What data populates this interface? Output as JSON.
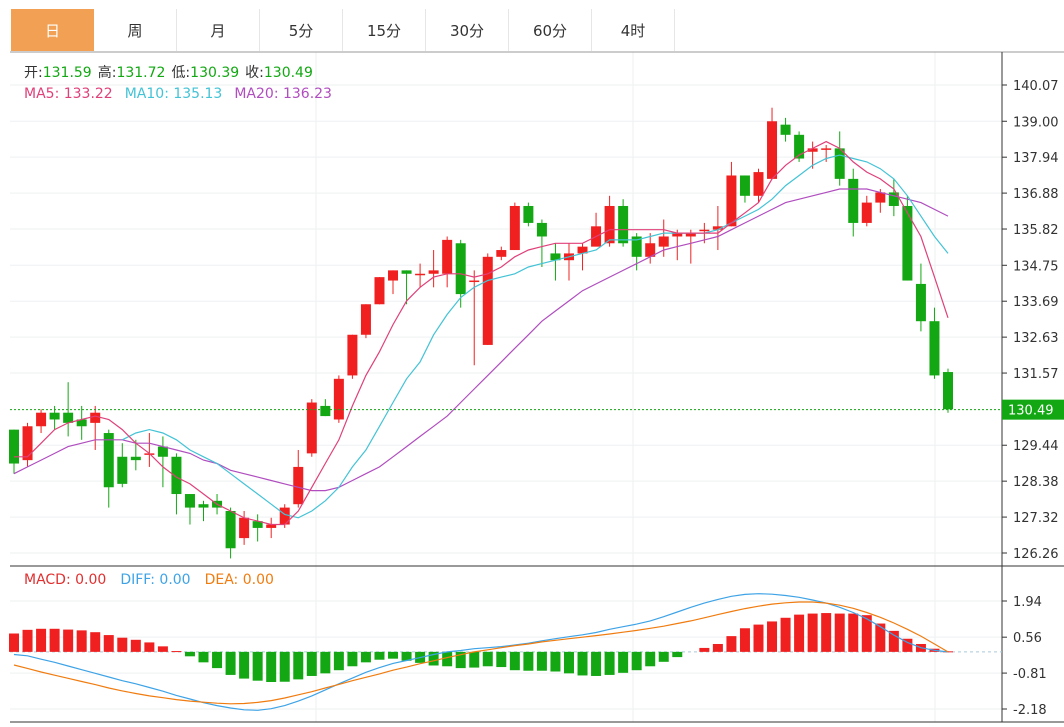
{
  "tabs": [
    "日",
    "周",
    "月",
    "5分",
    "15分",
    "30分",
    "60分",
    "4时"
  ],
  "active_tab": 0,
  "ohlc_label": {
    "open_k": "开:",
    "open": "131.59",
    "high_k": "高:",
    "high": "131.72",
    "low_k": "低:",
    "low": "130.39",
    "close_k": "收:",
    "close": "130.49"
  },
  "ma_label": {
    "ma5": "MA5: 133.22",
    "ma10": "MA10: 135.13",
    "ma20": "MA20: 136.23"
  },
  "macd_label": {
    "macd": "MACD: 0.00",
    "diff": "DIFF: 0.00",
    "dea": "DEA: 0.00"
  },
  "last_price": "130.49",
  "colors": {
    "up": "#f02020",
    "down": "#13a813",
    "ma5": "#e0407a",
    "ma10": "#43c3d6",
    "ma20": "#b04dbf",
    "diff": "#3ea3e6",
    "dea": "#f07c10",
    "accent": "#f2a053"
  },
  "chart_data": {
    "type": "candlestick",
    "price_axis": [
      "140.07",
      "139.00",
      "137.94",
      "136.88",
      "135.82",
      "134.75",
      "133.69",
      "132.63",
      "131.57",
      "129.44",
      "128.38",
      "127.32",
      "126.26"
    ],
    "price_ylim": [
      126.26,
      140.07
    ],
    "macd_axis": [
      "1.94",
      "0.56",
      "-0.81",
      "-2.18"
    ],
    "macd_ylim": [
      -2.18,
      1.94
    ],
    "candles": [
      [
        129.9,
        128.9,
        129.9,
        128.6
      ],
      [
        129.0,
        130.0,
        130.1,
        128.8
      ],
      [
        130.0,
        130.4,
        130.5,
        129.8
      ],
      [
        130.4,
        130.2,
        130.6,
        129.9
      ],
      [
        130.4,
        130.1,
        131.3,
        129.7
      ],
      [
        130.2,
        130.0,
        130.6,
        129.6
      ],
      [
        130.1,
        130.4,
        130.6,
        129.3
      ],
      [
        129.8,
        128.2,
        129.9,
        127.6
      ],
      [
        129.1,
        128.3,
        129.5,
        128.2
      ],
      [
        129.1,
        129.0,
        129.6,
        128.7
      ],
      [
        129.2,
        129.2,
        129.8,
        128.8
      ],
      [
        129.4,
        129.1,
        129.7,
        128.2
      ],
      [
        129.1,
        128.0,
        129.2,
        127.4
      ],
      [
        128.0,
        127.6,
        128.0,
        127.1
      ],
      [
        127.7,
        127.6,
        127.8,
        127.2
      ],
      [
        127.8,
        127.6,
        128.0,
        127.4
      ],
      [
        127.5,
        126.4,
        127.6,
        126.1
      ],
      [
        126.7,
        127.3,
        127.5,
        126.5
      ],
      [
        127.2,
        127.0,
        127.4,
        126.6
      ],
      [
        127.0,
        127.1,
        127.3,
        126.7
      ],
      [
        127.1,
        127.6,
        127.7,
        127.0
      ],
      [
        127.7,
        128.8,
        129.3,
        127.6
      ],
      [
        129.2,
        130.7,
        130.8,
        129.1
      ],
      [
        130.6,
        130.3,
        130.8,
        130.3
      ],
      [
        130.2,
        131.4,
        131.5,
        130.1
      ],
      [
        131.5,
        132.7,
        132.7,
        131.4
      ],
      [
        132.7,
        133.6,
        133.6,
        132.6
      ],
      [
        133.6,
        134.4,
        134.4,
        133.6
      ],
      [
        134.3,
        134.6,
        134.6,
        133.9
      ],
      [
        134.6,
        134.5,
        134.6,
        133.6
      ],
      [
        134.5,
        134.5,
        134.8,
        134.1
      ],
      [
        134.5,
        134.6,
        135.2,
        134.1
      ],
      [
        134.5,
        135.5,
        135.6,
        134.1
      ],
      [
        135.4,
        133.9,
        135.5,
        133.5
      ],
      [
        134.3,
        134.3,
        134.6,
        131.8
      ],
      [
        132.4,
        135.0,
        135.1,
        132.4
      ],
      [
        135.0,
        135.2,
        135.3,
        134.9
      ],
      [
        135.2,
        136.5,
        136.6,
        135.2
      ],
      [
        136.5,
        136.0,
        136.6,
        135.9
      ],
      [
        136.0,
        135.6,
        136.1,
        134.7
      ],
      [
        135.1,
        134.9,
        135.4,
        134.3
      ],
      [
        134.9,
        135.1,
        135.4,
        134.3
      ],
      [
        135.1,
        135.3,
        135.4,
        134.6
      ],
      [
        135.3,
        135.9,
        136.3,
        135.4
      ],
      [
        135.4,
        136.5,
        136.8,
        135.3
      ],
      [
        136.5,
        135.4,
        136.7,
        135.3
      ],
      [
        135.6,
        135.0,
        135.7,
        134.6
      ],
      [
        135.0,
        135.4,
        135.7,
        134.8
      ],
      [
        135.3,
        135.6,
        136.1,
        135.0
      ],
      [
        135.6,
        135.7,
        135.8,
        134.9
      ],
      [
        135.6,
        135.7,
        135.8,
        134.8
      ],
      [
        135.8,
        135.8,
        136.0,
        135.4
      ],
      [
        135.8,
        135.9,
        136.5,
        135.2
      ],
      [
        135.9,
        137.4,
        137.8,
        135.9
      ],
      [
        137.4,
        136.8,
        137.4,
        136.6
      ],
      [
        136.8,
        137.5,
        137.6,
        136.6
      ],
      [
        137.3,
        139.0,
        139.4,
        137.3
      ],
      [
        138.9,
        138.6,
        139.1,
        138.4
      ],
      [
        138.6,
        137.9,
        138.7,
        137.8
      ],
      [
        138.1,
        138.2,
        138.4,
        137.6
      ],
      [
        138.2,
        138.2,
        138.3,
        137.8
      ],
      [
        138.2,
        137.3,
        138.7,
        137.1
      ],
      [
        137.3,
        136.0,
        137.6,
        135.6
      ],
      [
        136.0,
        136.6,
        136.8,
        135.9
      ],
      [
        136.6,
        136.9,
        137.0,
        136.3
      ],
      [
        136.9,
        136.5,
        137.3,
        136.2
      ],
      [
        136.5,
        134.3,
        136.8,
        134.3
      ],
      [
        134.2,
        133.1,
        134.8,
        132.8
      ],
      [
        133.1,
        131.5,
        133.5,
        131.4
      ],
      [
        131.6,
        130.5,
        131.7,
        130.4
      ]
    ],
    "ma5": [
      129.1,
      129.1,
      129.5,
      129.9,
      130.1,
      130.2,
      130.3,
      130.2,
      129.9,
      129.5,
      129.2,
      128.8,
      128.5,
      128.3,
      128.0,
      127.7,
      127.5,
      127.3,
      127.2,
      127.1,
      127.1,
      127.5,
      128.2,
      128.9,
      129.6,
      130.6,
      131.5,
      132.2,
      133.0,
      133.7,
      134.1,
      134.4,
      134.5,
      134.5,
      134.4,
      134.5,
      134.7,
      135.0,
      135.2,
      135.3,
      135.4,
      135.4,
      135.4,
      135.6,
      135.8,
      135.8,
      135.8,
      135.8,
      135.8,
      135.7,
      135.7,
      135.7,
      135.7,
      136.0,
      136.3,
      136.6,
      137.3,
      137.7,
      138.0,
      138.2,
      138.4,
      138.2,
      137.8,
      137.5,
      137.3,
      137.0,
      136.3,
      135.6,
      134.4,
      133.2
    ],
    "ma10": [
      null,
      null,
      null,
      null,
      null,
      null,
      null,
      null,
      129.6,
      129.8,
      129.9,
      129.8,
      129.6,
      129.3,
      129.1,
      128.9,
      128.6,
      128.3,
      128.0,
      127.7,
      127.4,
      127.3,
      127.5,
      127.8,
      128.2,
      128.8,
      129.3,
      130.0,
      130.7,
      131.4,
      131.9,
      132.7,
      133.3,
      133.8,
      134.1,
      134.3,
      134.4,
      134.5,
      134.7,
      134.8,
      134.9,
      135.0,
      135.1,
      135.2,
      135.5,
      135.5,
      135.5,
      135.6,
      135.7,
      135.7,
      135.7,
      135.7,
      135.8,
      136.0,
      136.2,
      136.4,
      136.7,
      137.1,
      137.4,
      137.7,
      137.9,
      138.0,
      137.9,
      137.8,
      137.6,
      137.3,
      136.8,
      136.2,
      135.6,
      135.1
    ],
    "ma20": [
      128.6,
      128.8,
      129.0,
      129.2,
      129.4,
      129.5,
      129.6,
      129.6,
      129.6,
      129.5,
      129.5,
      129.4,
      129.3,
      129.2,
      129.0,
      128.9,
      128.7,
      128.6,
      128.5,
      128.4,
      128.3,
      128.2,
      128.1,
      128.1,
      128.2,
      128.4,
      128.6,
      128.8,
      129.1,
      129.4,
      129.7,
      130.0,
      130.3,
      130.7,
      131.1,
      131.5,
      131.9,
      132.3,
      132.7,
      133.1,
      133.4,
      133.7,
      134.0,
      134.2,
      134.4,
      134.6,
      134.8,
      135.0,
      135.2,
      135.3,
      135.4,
      135.5,
      135.6,
      135.8,
      136.0,
      136.2,
      136.4,
      136.6,
      136.7,
      136.8,
      136.9,
      137.0,
      137.0,
      137.0,
      136.9,
      136.8,
      136.7,
      136.6,
      136.4,
      136.2
    ],
    "macd_hist": [
      0.7,
      0.84,
      0.88,
      0.88,
      0.85,
      0.82,
      0.75,
      0.64,
      0.54,
      0.46,
      0.36,
      0.21,
      0.03,
      -0.17,
      -0.4,
      -0.62,
      -0.88,
      -1.02,
      -1.1,
      -1.15,
      -1.14,
      -1.05,
      -0.92,
      -0.82,
      -0.7,
      -0.55,
      -0.4,
      -0.3,
      -0.26,
      -0.34,
      -0.42,
      -0.52,
      -0.55,
      -0.62,
      -0.6,
      -0.55,
      -0.58,
      -0.7,
      -0.72,
      -0.72,
      -0.75,
      -0.82,
      -0.9,
      -0.92,
      -0.88,
      -0.8,
      -0.7,
      -0.55,
      -0.38,
      -0.2,
      0.0,
      0.15,
      0.3,
      0.6,
      0.9,
      1.04,
      1.16,
      1.3,
      1.42,
      1.46,
      1.48,
      1.46,
      1.46,
      1.4,
      1.08,
      0.8,
      0.5,
      0.3,
      0.12,
      0.02
    ],
    "diff": [
      -0.1,
      -0.15,
      -0.28,
      -0.4,
      -0.54,
      -0.68,
      -0.82,
      -0.96,
      -1.1,
      -1.22,
      -1.36,
      -1.5,
      -1.66,
      -1.8,
      -1.94,
      -2.05,
      -2.14,
      -2.21,
      -2.23,
      -2.17,
      -2.05,
      -1.88,
      -1.68,
      -1.45,
      -1.22,
      -1.0,
      -0.78,
      -0.6,
      -0.44,
      -0.33,
      -0.22,
      -0.1,
      0.0,
      0.05,
      0.12,
      0.16,
      0.2,
      0.26,
      0.33,
      0.42,
      0.5,
      0.58,
      0.65,
      0.74,
      0.86,
      0.96,
      1.06,
      1.18,
      1.34,
      1.52,
      1.7,
      1.86,
      2.0,
      2.12,
      2.19,
      2.22,
      2.2,
      2.15,
      2.08,
      1.98,
      1.86,
      1.7,
      1.5,
      1.26,
      0.96,
      0.64,
      0.36,
      0.16,
      0.06,
      0.0
    ],
    "dea": [
      -0.5,
      -0.63,
      -0.77,
      -0.89,
      -1.01,
      -1.13,
      -1.25,
      -1.38,
      -1.49,
      -1.59,
      -1.68,
      -1.75,
      -1.82,
      -1.88,
      -1.92,
      -1.96,
      -1.98,
      -1.97,
      -1.93,
      -1.86,
      -1.76,
      -1.64,
      -1.52,
      -1.38,
      -1.24,
      -1.1,
      -0.97,
      -0.84,
      -0.7,
      -0.58,
      -0.45,
      -0.34,
      -0.22,
      -0.11,
      0.0,
      0.08,
      0.16,
      0.24,
      0.3,
      0.38,
      0.44,
      0.5,
      0.56,
      0.62,
      0.68,
      0.75,
      0.82,
      0.9,
      0.98,
      1.08,
      1.18,
      1.3,
      1.42,
      1.54,
      1.65,
      1.74,
      1.82,
      1.87,
      1.9,
      1.9,
      1.86,
      1.78,
      1.66,
      1.5,
      1.32,
      1.1,
      0.86,
      0.6,
      0.3,
      0.0
    ]
  }
}
